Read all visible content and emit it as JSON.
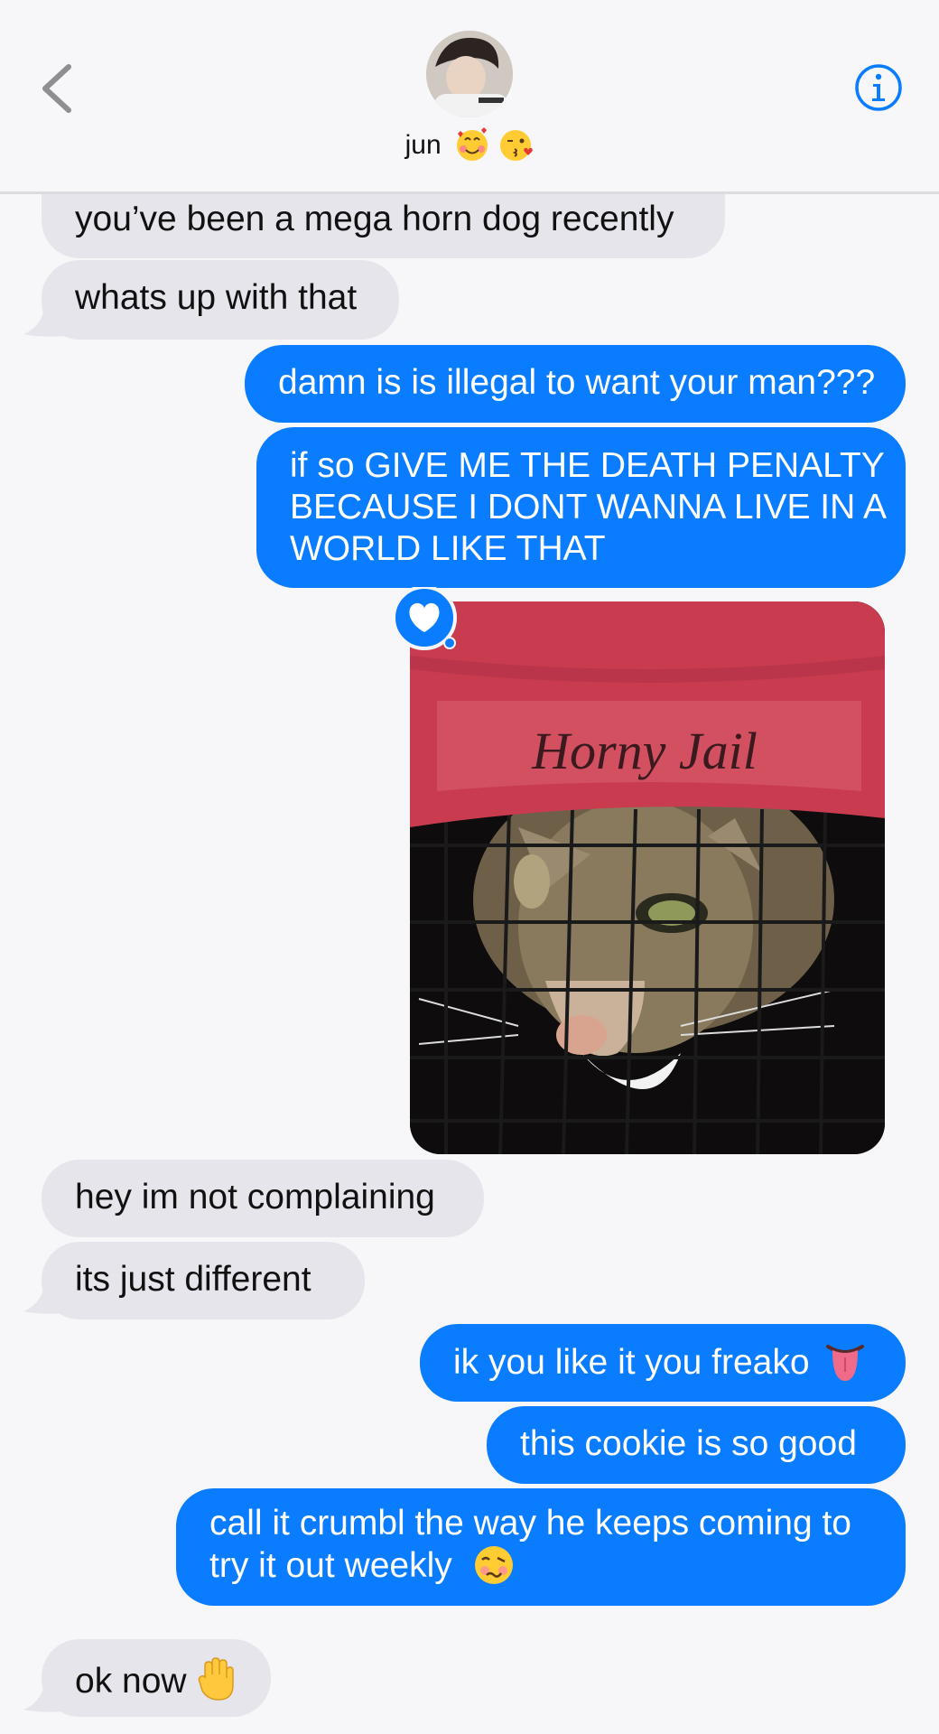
{
  "header": {
    "contact_name": "jun",
    "contact_emojis": [
      "smiling-face-with-hearts",
      "face-blowing-kiss"
    ]
  },
  "messages": [
    {
      "from": "them",
      "text": "you’ve been a mega horn dog recently"
    },
    {
      "from": "them",
      "text": "whats up with that"
    },
    {
      "from": "me",
      "text": "damn is is illegal to want your man???"
    },
    {
      "from": "me",
      "lines": [
        "if so GIVE ME THE DEATH PENALTY",
        "BECAUSE I DONT WANNA LIVE IN A",
        "WORLD LIKE THAT"
      ]
    },
    {
      "from": "me",
      "type": "image",
      "caption_in_image": "Horny Jail",
      "reaction": "heart"
    },
    {
      "from": "them",
      "text": "hey im not complaining"
    },
    {
      "from": "them",
      "text": "its just different"
    },
    {
      "from": "me",
      "text": "ik you like it you freako",
      "emoji": "tongue"
    },
    {
      "from": "me",
      "text": "this cookie is so good"
    },
    {
      "from": "me",
      "lines": [
        "call it crumbl the way he keeps coming to",
        "try it out weekly"
      ],
      "emoji": "woozy-face"
    },
    {
      "from": "them",
      "text": "ok now",
      "emoji": "raised-hand"
    }
  ],
  "colors": {
    "outgoing": "#0a7cff",
    "incoming": "#e6e5eb",
    "background": "#f7f7f9",
    "accent": "#0a7cff"
  }
}
